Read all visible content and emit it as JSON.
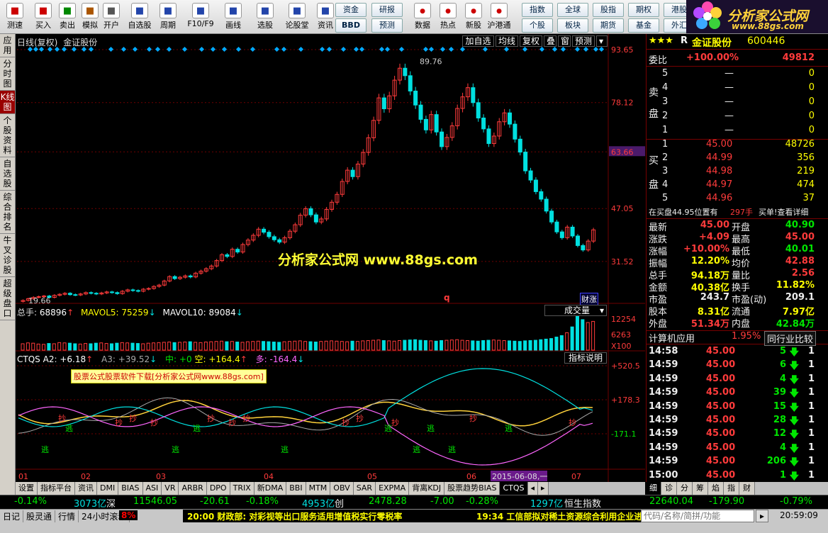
{
  "toolbar": {
    "buttons": [
      {
        "label": "测速",
        "icon": "clock-icon"
      },
      {
        "label": "买入",
        "icon": "buy-icon"
      },
      {
        "label": "卖出",
        "icon": "sell-icon"
      },
      {
        "label": "模拟",
        "icon": "hammer-icon"
      },
      {
        "label": "开户",
        "icon": "lock-icon"
      },
      {
        "label": "自选股",
        "icon": "grid-icon"
      },
      {
        "label": "周期",
        "icon": "cycle-icon"
      },
      {
        "label": "F10/F9",
        "icon": "f10-icon"
      },
      {
        "label": "画线",
        "icon": "pen-icon"
      },
      {
        "label": "选股",
        "icon": "select-icon"
      },
      {
        "label": "论股堂",
        "icon": "chat-icon"
      },
      {
        "label": "资讯",
        "icon": "news-icon"
      }
    ],
    "small_buttons": [
      "资金",
      "研报",
      "BBD",
      "预测"
    ],
    "right_buttons": [
      {
        "label": "数据",
        "icon": "pe-icon"
      },
      {
        "label": "热点",
        "icon": "fire-icon"
      },
      {
        "label": "新股",
        "icon": "ipo-icon"
      },
      {
        "label": "沪港通",
        "icon": "hkex-icon"
      }
    ],
    "market_buttons": [
      "指数",
      "全球",
      "股指",
      "期权",
      "港股",
      "个股",
      "板块",
      "期货",
      "基金",
      "外汇"
    ],
    "stock_label": "金证股份",
    "stock_code": "600446"
  },
  "logo": {
    "title": "分析家公式网",
    "url": "www.88gs.com"
  },
  "left_tabs": [
    "应用",
    "分时图",
    "K线图",
    "个股资料",
    "自选股",
    "综合排名",
    "牛叉诊股",
    "超级盘口"
  ],
  "chart": {
    "header_label": "日线(复权)",
    "stock_name": "金证股份",
    "header_buttons": [
      "加自选",
      "均线",
      "复权",
      "叠",
      "窗",
      "预测"
    ],
    "price_axis": [
      "93.65",
      "78.12",
      "63.66",
      "47.05",
      "31.52"
    ],
    "current_price_tag": "63.66",
    "high_label": "89.76",
    "low_label": "19.66",
    "watermark": "分析家公式网  www.88gs.com",
    "finance_badge": "财涨",
    "volume": {
      "title": "总手",
      "value": "68896",
      "ma5_label": "MAVOL5",
      "ma5": "75259",
      "ma10_label": "MAVOL10",
      "ma10": "89084",
      "dropdown": "成交量",
      "axis": [
        "12254",
        "6263",
        "X100"
      ]
    },
    "indicator": {
      "name": "CTQS",
      "a2_label": "A2",
      "a2": "+6.18",
      "a3_label": "A3",
      "a3": "+39.52",
      "mid_label": "中",
      "mid": "+0",
      "kong_label": "空",
      "kong": "+164.4",
      "duo_label": "多",
      "duo": "-164.4",
      "explain": "指标说明",
      "axis": [
        "+520.5",
        "+178.3",
        "-171.1"
      ],
      "banner": "股票公式股票软件下载[分析家公式网www.88gs.com]",
      "buy_text": "抄",
      "sell_text": "逃"
    },
    "dates": [
      "01",
      "02",
      "03",
      "04",
      "05",
      "06",
      "2015-06-08,一",
      "07"
    ],
    "colors": {
      "up": "#ff3b3b",
      "down": "#00e0e0",
      "axis": "#700000"
    }
  },
  "chart_data": {
    "type": "candlestick",
    "title": "日线(复权) 金证股份",
    "ylim": [
      19.66,
      93.65
    ],
    "price_axis_ticks": [
      93.65,
      78.12,
      63.66,
      47.05,
      31.52
    ],
    "high": 89.76,
    "low": 19.66,
    "month_labels": [
      "01",
      "02",
      "03",
      "04",
      "05",
      "06",
      "07"
    ],
    "close_series": [
      20.1,
      20.6,
      21.0,
      21.2,
      21.4,
      21.0,
      21.6,
      21.9,
      22.2,
      21.8,
      21.7,
      22.0,
      22.4,
      22.2,
      22.0,
      22.3,
      22.6,
      22.4,
      22.1,
      22.8,
      23.2,
      23.0,
      22.8,
      23.4,
      23.6,
      24.2,
      24.6,
      25.8,
      27.1,
      26.5,
      26.9,
      27.3,
      27.0,
      28.1,
      28.7,
      29.4,
      30.2,
      31.8,
      33.5,
      33.0,
      35.1,
      34.3,
      36.5,
      37.8,
      39.2,
      41.0,
      40.1,
      38.8,
      37.9,
      37.2,
      38.5,
      40.4,
      42.3,
      45.1,
      47.0,
      45.2,
      43.1,
      44.0,
      46.8,
      48.9,
      51.2,
      55.0,
      58.3,
      56.4,
      60.1,
      63.5,
      67.8,
      72.9,
      79.5,
      76.3,
      80.1,
      84.7,
      88.2,
      86.0,
      81.5,
      77.4,
      73.2,
      70.1,
      74.6,
      69.5,
      65.2,
      67.9,
      71.3,
      76.4,
      79.8,
      82.5,
      78.1,
      73.6,
      70.4,
      66.1,
      68.3,
      72.5,
      75.1,
      71.8,
      67.4,
      63.6,
      58.1,
      55.4,
      52.0,
      49.8,
      46.3,
      43.1,
      40.2,
      38.5,
      41.6,
      39.0,
      36.2,
      34.9,
      37.5,
      40.8
    ],
    "volume_series": [
      22,
      25,
      24,
      21,
      20,
      23,
      22,
      26,
      25,
      24,
      22,
      21,
      23,
      22,
      24,
      25,
      23,
      22,
      24,
      26,
      25,
      24,
      23,
      22,
      24,
      25,
      26,
      27,
      28,
      26,
      27,
      28,
      29,
      27,
      26,
      28,
      29,
      30,
      31,
      29,
      30,
      28,
      27,
      29,
      30,
      31,
      30,
      29,
      28,
      27,
      29,
      30,
      31,
      32,
      30,
      29,
      28,
      30,
      31,
      32,
      31,
      30,
      29,
      31,
      30,
      32,
      33,
      34,
      35,
      33,
      32,
      31,
      33,
      34,
      35,
      36,
      34,
      33,
      32,
      31,
      33,
      34,
      35,
      36,
      34,
      33,
      32,
      31,
      33,
      34,
      35,
      34,
      33,
      32,
      31,
      30,
      32,
      33,
      34,
      36,
      38,
      40,
      45,
      50,
      60,
      80,
      122,
      105,
      95,
      99
    ]
  },
  "right": {
    "title": "金证股份",
    "code": "600446",
    "stars": "★★★",
    "r_mark": "R",
    "weibi_label": "委比",
    "weibi": "+100.00%",
    "weicha": "49812",
    "sell_label": [
      "卖",
      "盘"
    ],
    "buy_label": [
      "买",
      "盘"
    ],
    "sell_rows": [
      {
        "n": "5",
        "p": "—",
        "v": "0"
      },
      {
        "n": "4",
        "p": "—",
        "v": "0"
      },
      {
        "n": "3",
        "p": "—",
        "v": "0"
      },
      {
        "n": "2",
        "p": "—",
        "v": "0"
      },
      {
        "n": "1",
        "p": "—",
        "v": "0"
      }
    ],
    "buy_rows": [
      {
        "n": "1",
        "p": "45.00",
        "v": "48726"
      },
      {
        "n": "2",
        "p": "44.99",
        "v": "356"
      },
      {
        "n": "3",
        "p": "44.98",
        "v": "219"
      },
      {
        "n": "4",
        "p": "44.97",
        "v": "474"
      },
      {
        "n": "5",
        "p": "44.96",
        "v": "37"
      }
    ],
    "inbuy": "在买盘44.95位置有",
    "inbuy_hand": "297手",
    "buy_note": "买单!查看详细",
    "quote": [
      {
        "l1": "最新",
        "v1": "45.00",
        "l2": "开盘",
        "v2": "40.90",
        "c1": "red",
        "c2": "grn"
      },
      {
        "l1": "涨跌",
        "v1": "+4.09",
        "l2": "最高",
        "v2": "45.00",
        "c1": "red",
        "c2": "red"
      },
      {
        "l1": "涨幅",
        "v1": "+10.00%",
        "l2": "最低",
        "v2": "40.01",
        "c1": "red",
        "c2": "grn"
      },
      {
        "l1": "振幅",
        "v1": "12.20%",
        "l2": "均价",
        "v2": "42.88",
        "c1": "yel",
        "c2": "red"
      },
      {
        "l1": "总手",
        "v1": "94.18万",
        "l2": "量比",
        "v2": "2.56",
        "c1": "yel",
        "c2": "red"
      },
      {
        "l1": "金额",
        "v1": "40.38亿",
        "l2": "换手",
        "v2": "11.82%",
        "c1": "yel",
        "c2": "yel"
      },
      {
        "l1": "市盈",
        "v1": "243.7",
        "l2": "市盈(动)",
        "v2": "209.1",
        "c1": "wht",
        "c2": "wht"
      },
      {
        "l1": "股本",
        "v1": "8.31亿",
        "l2": "流通",
        "v2": "7.97亿",
        "c1": "yel",
        "c2": "yel"
      },
      {
        "l1": "外盘",
        "v1": "51.34万",
        "l2": "内盘",
        "v2": "42.84万",
        "c1": "red",
        "c2": "grn"
      }
    ],
    "sector": "计算机应用",
    "sector_pct": "1.95%",
    "compare_btn": "同行业比较",
    "ticks": [
      {
        "t": "14:58",
        "p": "45.00",
        "v": "5",
        "d": "1"
      },
      {
        "t": "14:59",
        "p": "45.00",
        "v": "6",
        "d": "1"
      },
      {
        "t": "14:59",
        "p": "45.00",
        "v": "4",
        "d": "1"
      },
      {
        "t": "14:59",
        "p": "45.00",
        "v": "39",
        "d": "1"
      },
      {
        "t": "14:59",
        "p": "45.00",
        "v": "15",
        "d": "1"
      },
      {
        "t": "14:59",
        "p": "45.00",
        "v": "28",
        "d": "1"
      },
      {
        "t": "14:59",
        "p": "45.00",
        "v": "12",
        "d": "1"
      },
      {
        "t": "14:59",
        "p": "45.00",
        "v": "4",
        "d": "1"
      },
      {
        "t": "14:59",
        "p": "45.00",
        "v": "206",
        "d": "1"
      },
      {
        "t": "15:00",
        "p": "45.00",
        "v": "1",
        "d": "1"
      }
    ],
    "tabs": [
      "细",
      "诊",
      "分",
      "筹",
      "焰",
      "指",
      "财"
    ]
  },
  "indicator_tabs": [
    "设置",
    "指标平台",
    "资讯",
    "DMI",
    "BIAS",
    "ASI",
    "VR",
    "ARBR",
    "DPO",
    "TRIX",
    "新DMA",
    "BBI",
    "MTM",
    "OBV",
    "SAR",
    "EXPMA",
    "背离KDJ",
    "股票趋势BIAS",
    "CTQS"
  ],
  "active_indicator": "CTQS",
  "index_bar": {
    "sh_pct": "-0.14%",
    "sz_amt": "3073亿",
    "sz_name": "深",
    "sz_val": "11546.05",
    "sz_chg": "-20.61",
    "sz_pct": "-0.18%",
    "cy_amt": "4953亿",
    "cy_name": "创",
    "cy_val": "2478.28",
    "cy_chg": "-7.00",
    "cy_pct": "-0.28%",
    "hs_amt": "1297亿",
    "hs_name": "恒生指数",
    "hs_val": "22640.04",
    "hs_chg": "-179.90",
    "hs_pct": "-0.79%"
  },
  "status": {
    "tabs": [
      "日记",
      "股灵通",
      "行情",
      "24小时滚动"
    ],
    "pct_frag": "8%",
    "news1": "20:00 财政部: 对彩视等出口服务适用增值税实行零税率",
    "news2": "19:34 工信部拟对稀土资源综合利用企业进",
    "search_placeholder": "代码/名称/简拼/功能",
    "clock": "20:59:09"
  }
}
